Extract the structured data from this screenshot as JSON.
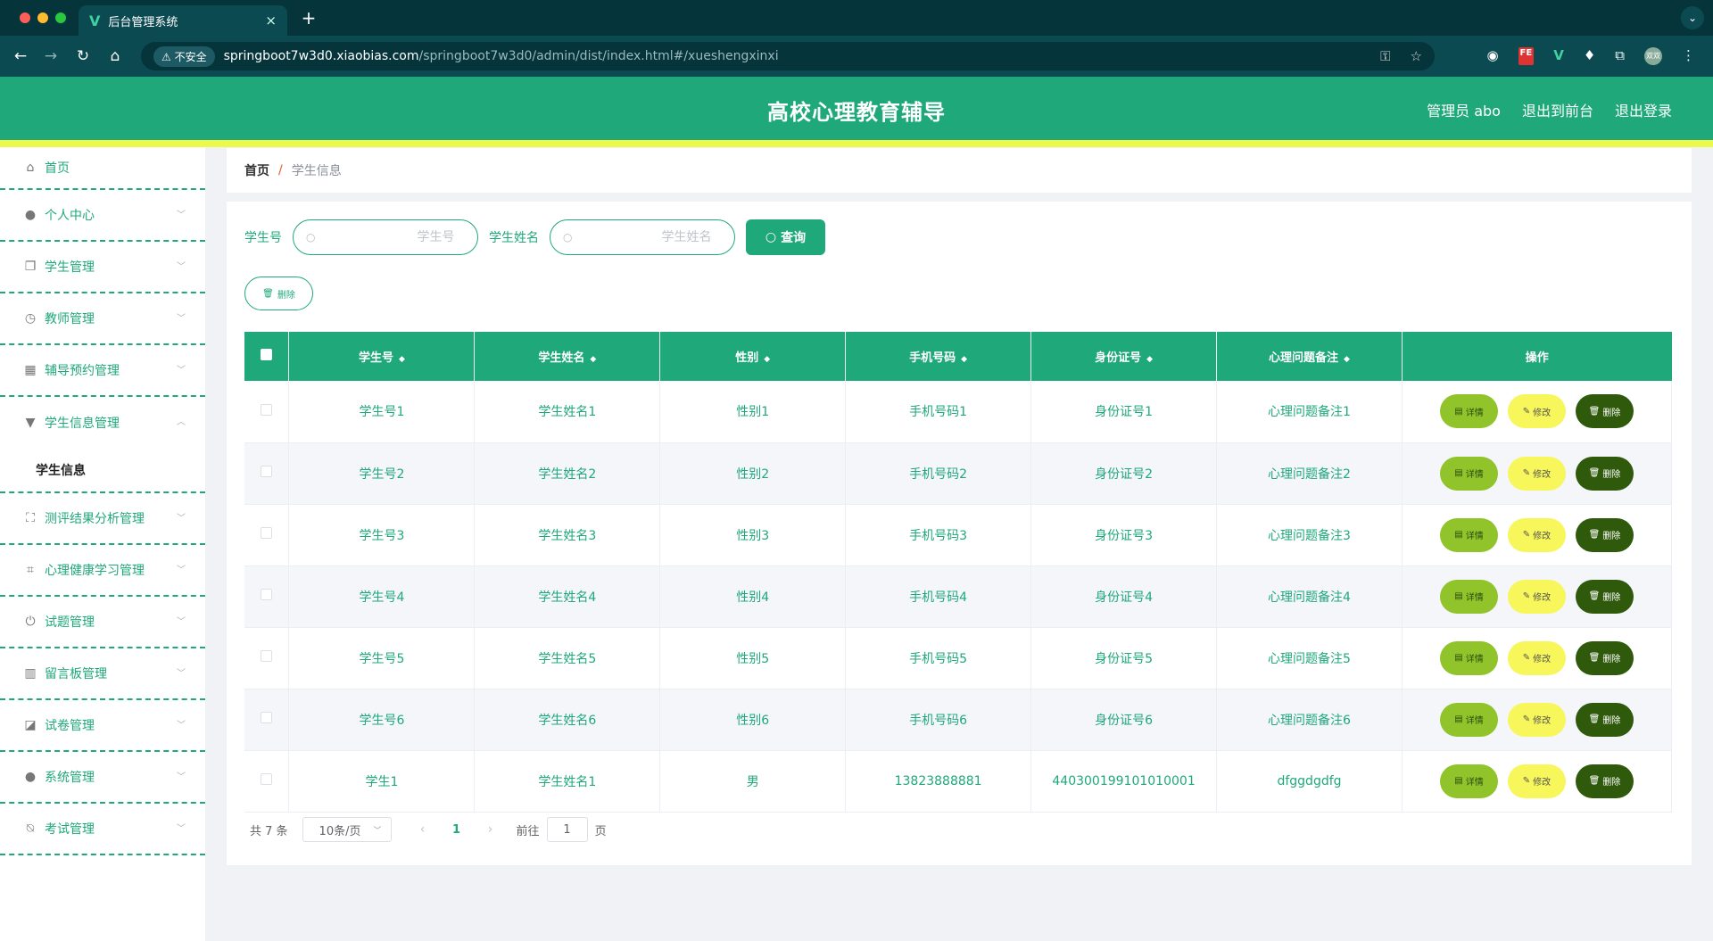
{
  "browser": {
    "tab_title": "后台管理系统",
    "tab_close": "×",
    "new_tab": "+",
    "insecure_label": "不安全",
    "url_host": "springboot7w3d0.xiaobias.com",
    "url_path": "/springboot7w3d0/admin/dist/index.html#/xueshengxinxi",
    "ext_fe": "FE",
    "ext_v": "V",
    "avatar_text": "双双"
  },
  "header": {
    "title": "高校心理教育辅导",
    "admin_label": "管理员 abo",
    "to_front": "退出到前台",
    "logout": "退出登录"
  },
  "sidebar": {
    "items": [
      {
        "label": "首页",
        "icon": "home-icon"
      },
      {
        "label": "个人中心",
        "icon": "user-icon"
      },
      {
        "label": "学生管理",
        "icon": "copy-icon"
      },
      {
        "label": "教师管理",
        "icon": "clock-icon"
      },
      {
        "label": "辅导预约管理",
        "icon": "grid-icon"
      },
      {
        "label": "学生信息管理",
        "icon": "cup-icon"
      },
      {
        "label": "测评结果分析管理",
        "icon": "fullscreen-icon"
      },
      {
        "label": "心理健康学习管理",
        "icon": "crop-icon"
      },
      {
        "label": "试题管理",
        "icon": "power-icon"
      },
      {
        "label": "留言板管理",
        "icon": "bars-icon"
      },
      {
        "label": "试卷管理",
        "icon": "chart-icon"
      },
      {
        "label": "系统管理",
        "icon": "user-icon"
      },
      {
        "label": "考试管理",
        "icon": "bell-off-icon"
      }
    ],
    "sub_active": "学生信息"
  },
  "breadcrumb": {
    "home": "首页",
    "separator": "/",
    "current": "学生信息"
  },
  "search": {
    "label_id": "学生号",
    "placeholder_id": "学生号",
    "label_name": "学生姓名",
    "placeholder_name": "学生姓名",
    "query_button": "查询"
  },
  "actions": {
    "delete_label": "删除"
  },
  "table": {
    "columns": [
      "学生号",
      "学生姓名",
      "性别",
      "手机号码",
      "身份证号",
      "心理问题备注",
      "操作"
    ],
    "rows": [
      {
        "id": "学生号1",
        "name": "学生姓名1",
        "gender": "性别1",
        "phone": "手机号码1",
        "idcard": "身份证号1",
        "note": "心理问题备注1"
      },
      {
        "id": "学生号2",
        "name": "学生姓名2",
        "gender": "性别2",
        "phone": "手机号码2",
        "idcard": "身份证号2",
        "note": "心理问题备注2"
      },
      {
        "id": "学生号3",
        "name": "学生姓名3",
        "gender": "性别3",
        "phone": "手机号码3",
        "idcard": "身份证号3",
        "note": "心理问题备注3"
      },
      {
        "id": "学生号4",
        "name": "学生姓名4",
        "gender": "性别4",
        "phone": "手机号码4",
        "idcard": "身份证号4",
        "note": "心理问题备注4"
      },
      {
        "id": "学生号5",
        "name": "学生姓名5",
        "gender": "性别5",
        "phone": "手机号码5",
        "idcard": "身份证号5",
        "note": "心理问题备注5"
      },
      {
        "id": "学生号6",
        "name": "学生姓名6",
        "gender": "性别6",
        "phone": "手机号码6",
        "idcard": "身份证号6",
        "note": "心理问题备注6"
      },
      {
        "id": "学生1",
        "name": "学生姓名1",
        "gender": "男",
        "phone": "13823888881",
        "idcard": "440300199101010001",
        "note": "dfggdgdfg"
      }
    ],
    "op_detail": "详情",
    "op_edit": "修改",
    "op_delete": "删除"
  },
  "pagination": {
    "total": "共 7 条",
    "page_size": "10条/页",
    "current_page": "1",
    "goto_prefix": "前往",
    "goto_value": "1",
    "goto_suffix": "页"
  },
  "colors": {
    "primary": "#1fa87a",
    "stripe": "#ecf94a",
    "detail_btn": "#90c42a",
    "edit_btn": "#f7f65a",
    "delete_btn": "#2f5a0c"
  }
}
